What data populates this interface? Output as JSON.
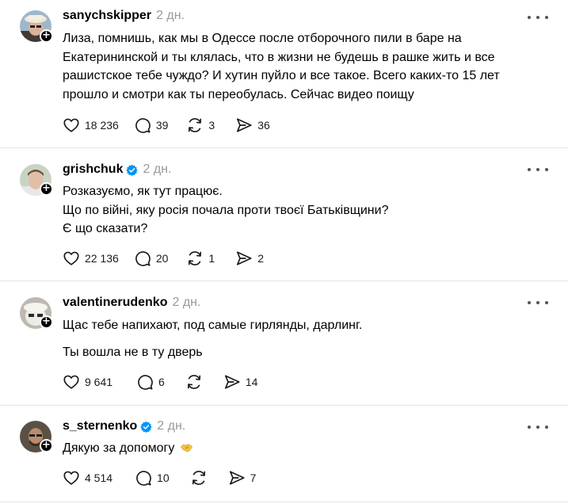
{
  "posts": [
    {
      "username": "sanychskipper",
      "verified": false,
      "time": "2 дн.",
      "lines": [
        "Лиза, помнишь, как мы в Одессе после отборочного пили в баре на",
        "Екатерининской и ты клялась, что в жизни не будешь в рашке жить и все",
        "рашистское тебе чуждо? И хутин пуйло и все такое. Всего каких-то 15 лет",
        "прошло и смотри как ты переобулась. Сейчас видео поищу"
      ],
      "likes": "18 236",
      "replies": "39",
      "reposts": "3",
      "shares": "36"
    },
    {
      "username": "grishchuk",
      "verified": true,
      "time": "2 дн.",
      "lines": [
        "Розказуємо, як тут працює.",
        "Що по війні, яку росія почала проти твоєї Батьківщини?",
        "Є що сказати?"
      ],
      "likes": "22 136",
      "replies": "20",
      "reposts": "1",
      "shares": "2"
    },
    {
      "username": "valentinerudenko",
      "verified": false,
      "time": "2 дн.",
      "paragraphs": [
        "Щас тебе напихают, под самые гирлянды, дарлинг.",
        "Ты вошла не в ту дверь"
      ],
      "likes": "9 641",
      "replies": "6",
      "reposts": "",
      "shares": "14"
    },
    {
      "username": "s_sternenko",
      "verified": true,
      "time": "2 дн.",
      "text": "Дякую за допомогу",
      "emoji": "handshake-emoji",
      "likes": "4 514",
      "replies": "10",
      "reposts": "",
      "shares": "7"
    }
  ],
  "colors": {
    "verified": "#0095f6",
    "time": "#999999",
    "divider": "#e3e3e3"
  }
}
